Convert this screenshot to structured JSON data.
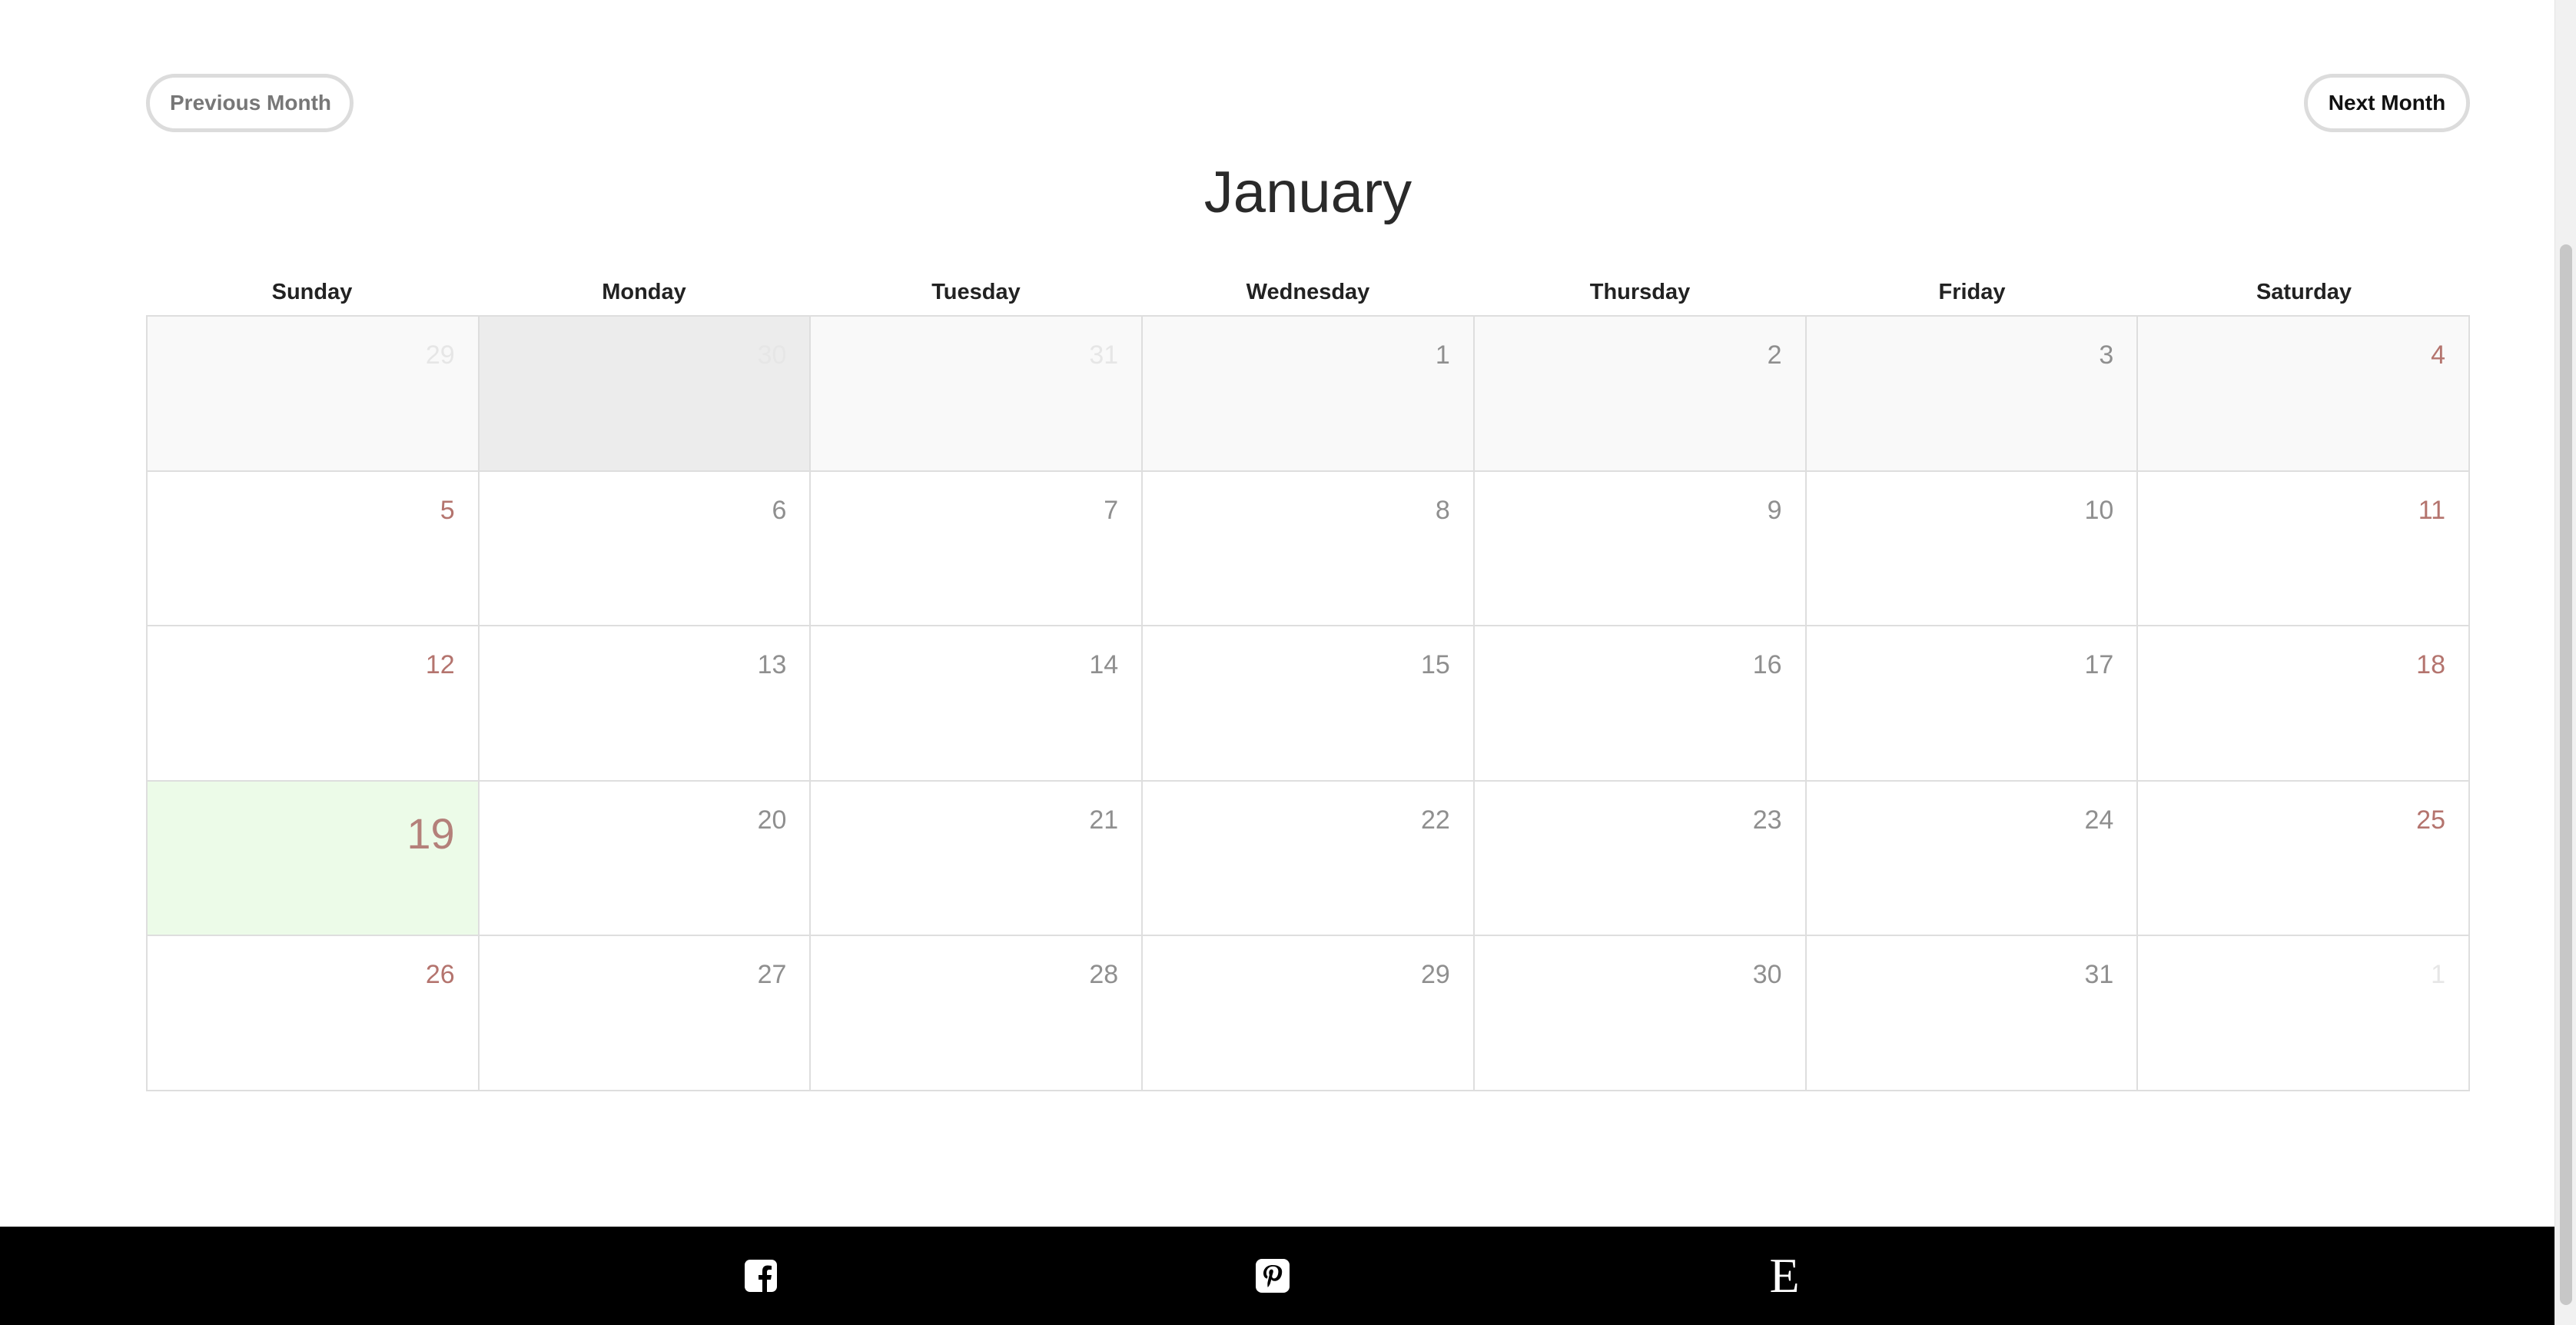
{
  "nav": {
    "previous_label": "Previous Month",
    "next_label": "Next Month"
  },
  "month_title": "January",
  "weekdays": [
    "Sunday",
    "Monday",
    "Tuesday",
    "Wednesday",
    "Thursday",
    "Friday",
    "Saturday"
  ],
  "weeks": [
    [
      "29",
      "30",
      "31",
      "1",
      "2",
      "3",
      "4"
    ],
    [
      "5",
      "6",
      "7",
      "8",
      "9",
      "10",
      "11"
    ],
    [
      "12",
      "13",
      "14",
      "15",
      "16",
      "17",
      "18"
    ],
    [
      "19",
      "20",
      "21",
      "22",
      "23",
      "24",
      "25"
    ],
    [
      "26",
      "27",
      "28",
      "29",
      "30",
      "31",
      "1"
    ]
  ],
  "today": "19",
  "footer": {
    "icons": [
      "facebook-icon",
      "pinterest-icon",
      "etsy-icon"
    ],
    "etsy_glyph": "E"
  },
  "colors": {
    "weekend_number": "#b4746e",
    "weekday_number": "#8f8f8f",
    "today_background": "#ecfbe8",
    "outside_month_number": "#e6e6e6",
    "footer_background": "#000000"
  }
}
